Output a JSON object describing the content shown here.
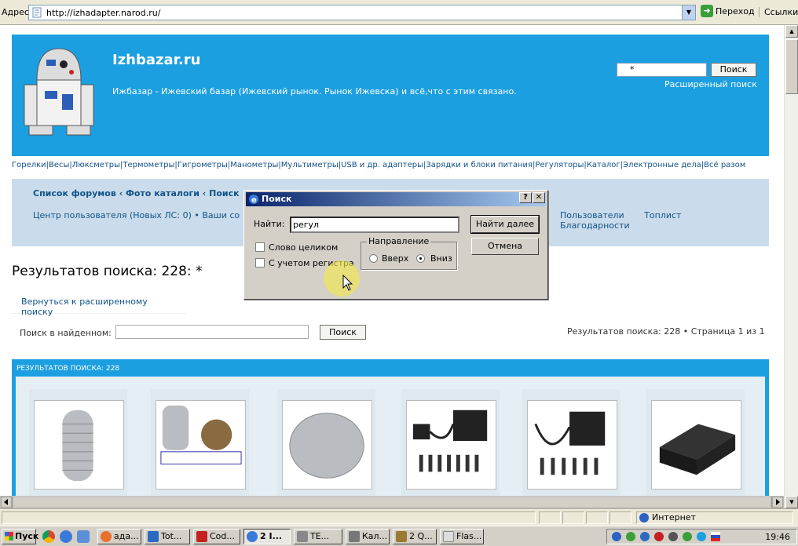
{
  "browser": {
    "address_label": "Адрес:",
    "url": "http://izhadapter.narod.ru/",
    "go_label": "Переход",
    "links_label": "Ссылки"
  },
  "header": {
    "site_title": "Izhbazar.ru",
    "site_desc": "Ижбазар - Ижевский базар (Ижевский рынок. Рынок Ижевска) и всё,что с этим связано.",
    "search_value": "*",
    "search_button": "Поиск",
    "advanced_search": "Расширенный поиск"
  },
  "categories": "Горелки|Весы|Люксметры|Термометры|Гигрометры|Манометры|Мультиметры|USB и др. адаптеры|Зарядки и блоки питания|Регуляторы|Каталог|Электронные дела|Всё разом",
  "navbar": {
    "breadcrumb": "Список форумов ‹ Фото каталоги ‹ Поиск",
    "user_center": "Центр пользователя (Новых ЛС: 0) • Ваши со",
    "links": [
      "Пользователи",
      "Топлист",
      "Благодарности"
    ]
  },
  "results": {
    "title": "Результатов поиска: 228: *",
    "back_link": "Вернуться к расширенному поиску",
    "search_in_label": "Поиск в найденном:",
    "search_in_button": "Поиск",
    "pager": "Результатов поиска: 228 • Страница 1 из 1",
    "block_header": "РЕЗУЛЬТАТОВ ПОИСКА: 228"
  },
  "find_dialog": {
    "title": "Поиск",
    "help_btn": "?",
    "close_btn": "✕",
    "find_label": "Найти:",
    "find_value": "регул",
    "find_next": "Найти далее",
    "cancel": "Отмена",
    "whole_word": "Слово целиком",
    "match_case": "С учетом регистра",
    "direction_label": "Направление",
    "up": "Вверх",
    "down": "Вниз"
  },
  "status": {
    "zone": "Интернет"
  },
  "taskbar": {
    "start": "Пуск",
    "buttons": [
      "ада...",
      "Tot...",
      "Cod...",
      "2 I...",
      "TE...",
      "Кал...",
      "2 Q...",
      "Flas..."
    ],
    "clock": "19:46"
  }
}
